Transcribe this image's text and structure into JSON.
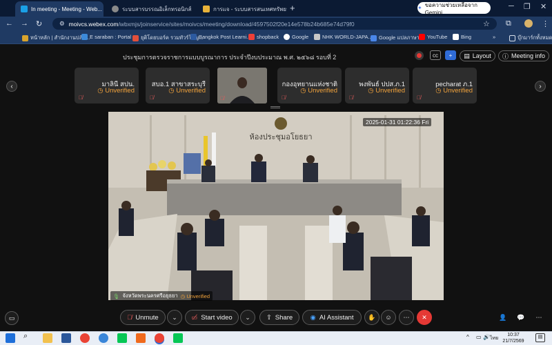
{
  "browser": {
    "tabs": [
      {
        "title": "In meeting - Meeting - Web...",
        "active": true
      },
      {
        "title": "ระบบสารบรรณอิเล็กทรอนิกส์",
        "active": false
      },
      {
        "title": "การแจ - ระบบสารสนเทศทรัพยากรบุ",
        "active": false
      }
    ],
    "new_tab": "+",
    "gemini_button": "ขอความช่วยเหลือจาก Gemini",
    "url_host": "moivcs.webex.com",
    "url_path": "/wbxmjs/joinservice/sites/moivcs/meeting/download/4597502f20e14e578b24b685e74d79f0",
    "bookmarks": [
      "หน้าหลัก | สำนักงานปลัด...",
      "E saraban : Portal",
      "ยุติโดยบอร์ค รวมทัวร์ใหญ...",
      "Bangkok Post Learni...",
      "shopback",
      "Google",
      "NHK WORLD-JAPA...",
      "Google แปลภาษา",
      "YouTube",
      "Bing",
      "บุ๊กมาร์กทั้งหมด"
    ]
  },
  "meeting": {
    "title": "ประชุมการตรวจราชการแบบบูรณาการ ประจำปีงบประมาณ พ.ศ. ๒๕๖๘ รอบที่ 2",
    "layout_label": "Layout",
    "info_label": "Meeting info",
    "participants": [
      {
        "name": "มาลินี สปน.",
        "status": "Unverified"
      },
      {
        "name": "สบอ.1 สาขาสระบุรี",
        "status": "Unverified"
      },
      {
        "name": "กองอุทยานแห่งชาติ",
        "status": "Unverified"
      },
      {
        "name": "พงพันธ์ ปปส.ภ.1",
        "status": "Unverified"
      },
      {
        "name": "pecharat ภ.1",
        "status": "Unverified"
      }
    ],
    "main_video": {
      "timestamp": "2025-01-31 01:22:36 Fri",
      "room_sign": "ห้องประชุมอโยธยา",
      "speaker_name": "จังหวัดพระนครศรีอยุธยา",
      "speaker_status": "Unverified"
    },
    "controls": {
      "unmute": "Unmute",
      "start_video": "Start video",
      "share": "Share",
      "ai_assistant": "AI Assistant"
    }
  },
  "taskbar": {
    "lang": "ไทย",
    "time": "10:37",
    "date": "21/7/2569"
  },
  "colors": {
    "chrome_bg": "#1f3a63",
    "leave_red": "#e53935",
    "unverified": "#f2a33c"
  }
}
